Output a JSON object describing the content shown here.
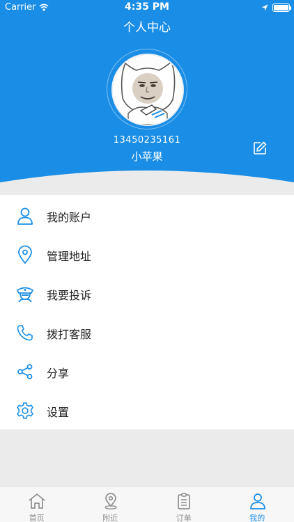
{
  "colors": {
    "primary": "#1a8ee6",
    "background": "#ebebeb",
    "text": "#222222",
    "tab_inactive": "#8e8e8e"
  },
  "status_bar": {
    "carrier": "Carrier",
    "time": "4:35 PM"
  },
  "header": {
    "title": "个人中心"
  },
  "profile": {
    "phone": "13450235161",
    "nickname": "小苹果",
    "edit_icon": "edit-icon"
  },
  "menu": {
    "items": [
      {
        "label": "我的账户",
        "icon": "user-icon"
      },
      {
        "label": "管理地址",
        "icon": "location-pin-icon"
      },
      {
        "label": "我要投诉",
        "icon": "police-icon"
      },
      {
        "label": "拨打客服",
        "icon": "phone-icon"
      },
      {
        "label": "分享",
        "icon": "share-icon"
      },
      {
        "label": "设置",
        "icon": "gear-icon"
      }
    ]
  },
  "tabbar": {
    "tabs": [
      {
        "label": "首页",
        "icon": "home-icon",
        "active": false
      },
      {
        "label": "附近",
        "icon": "map-pin-icon",
        "active": false
      },
      {
        "label": "订单",
        "icon": "clipboard-icon",
        "active": false
      },
      {
        "label": "我的",
        "icon": "user-icon",
        "active": true
      }
    ]
  }
}
